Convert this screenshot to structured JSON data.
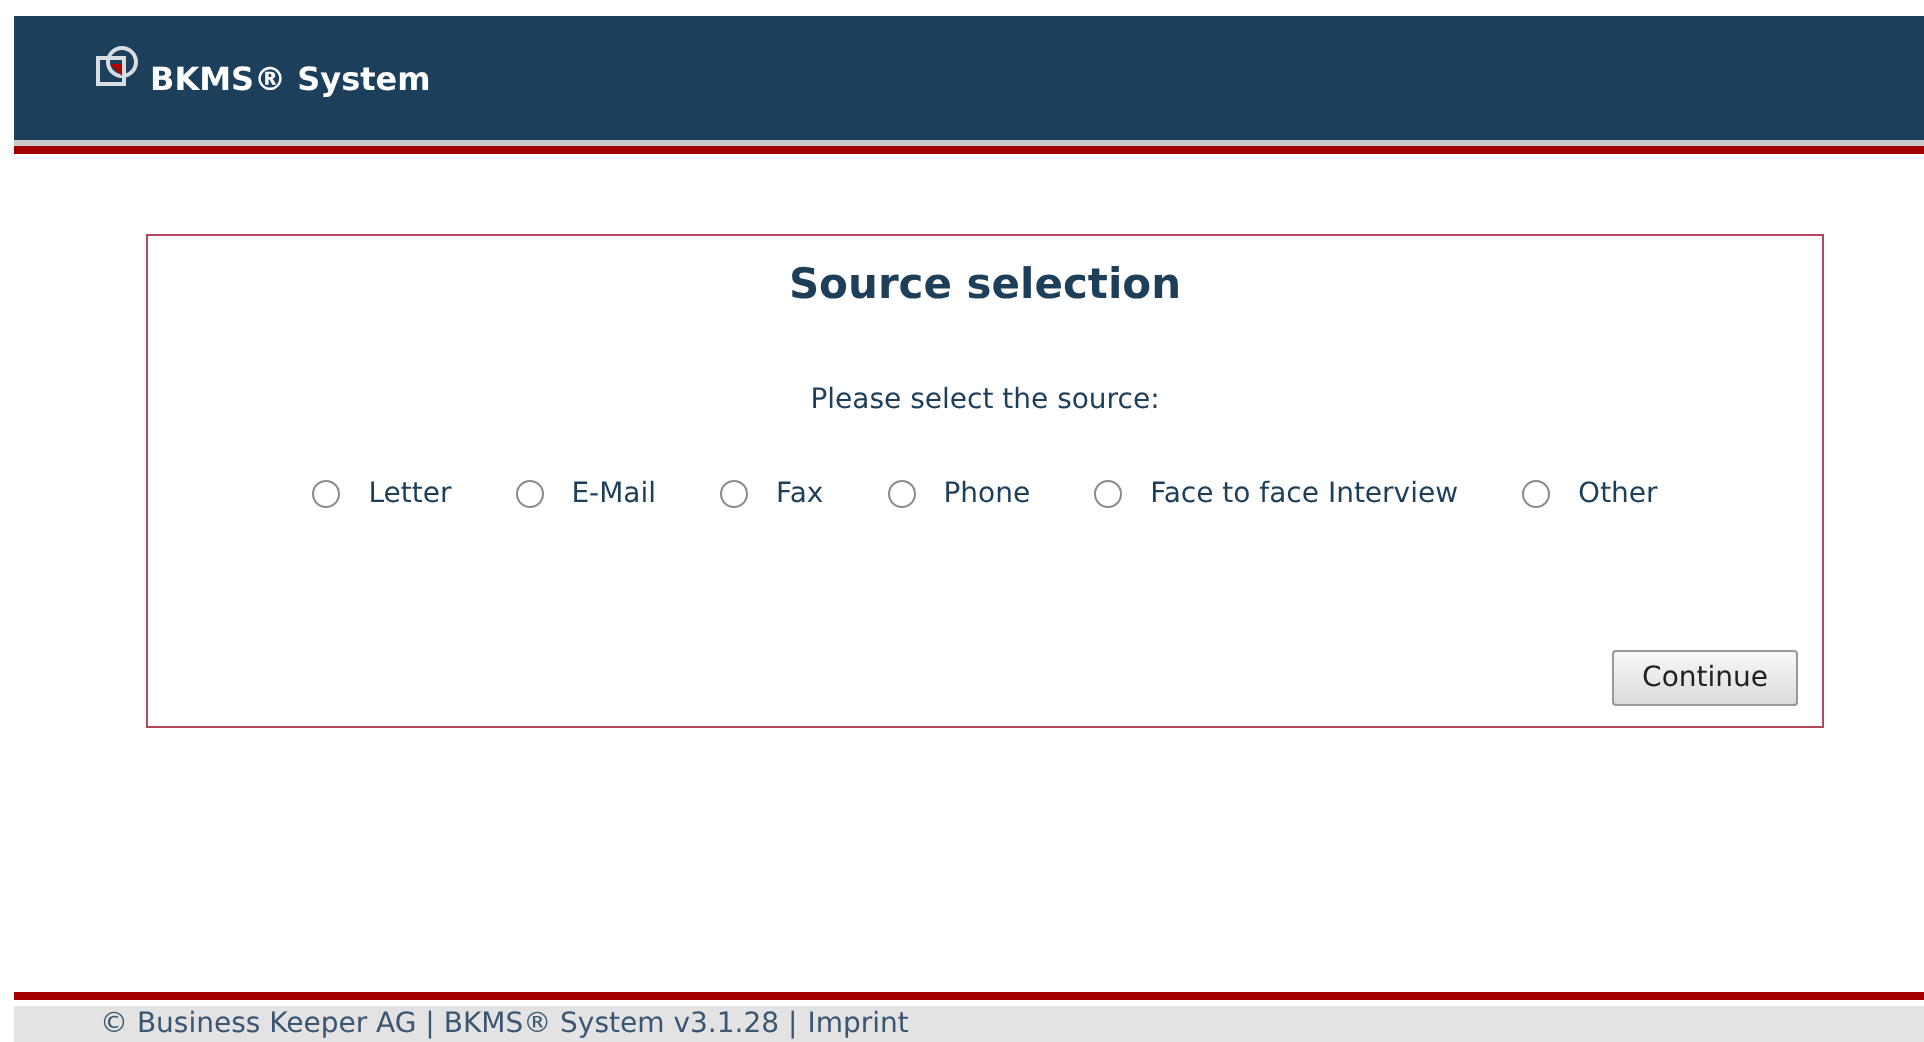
{
  "header": {
    "title": "BKMS® System"
  },
  "form": {
    "title": "Source selection",
    "prompt": "Please select the source:",
    "options": [
      {
        "label": "Letter",
        "selected": false
      },
      {
        "label": "E-Mail",
        "selected": false
      },
      {
        "label": "Fax",
        "selected": false
      },
      {
        "label": "Phone",
        "selected": false
      },
      {
        "label": "Face to face Interview",
        "selected": false
      },
      {
        "label": "Other",
        "selected": false
      }
    ],
    "button": "Continue"
  },
  "footer": {
    "text": "© Business Keeper AG | BKMS® System v3.1.28 |",
    "link": "Imprint"
  }
}
